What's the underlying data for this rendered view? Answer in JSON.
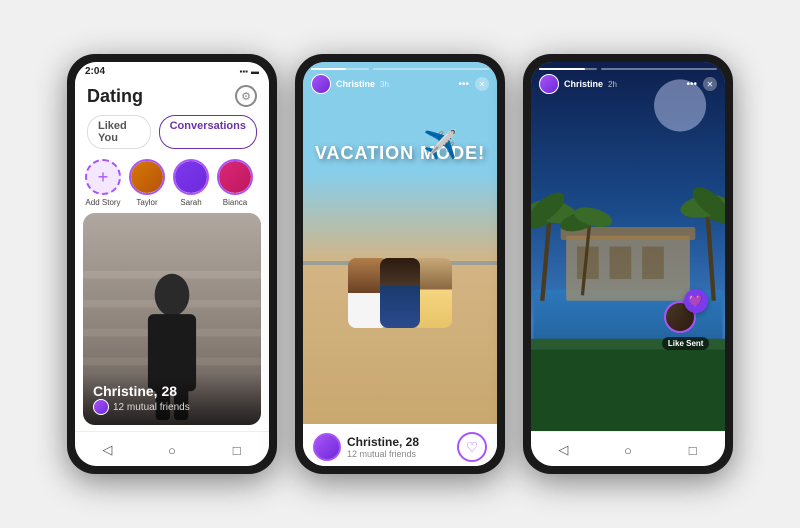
{
  "phone1": {
    "status_bar": {
      "time": "2:04",
      "icons": "▪▪ ▬"
    },
    "app_title": "Dating",
    "gear_label": "⚙",
    "tabs": [
      {
        "label": "Liked You",
        "id": "liked"
      },
      {
        "label": "Conversations",
        "id": "conversations"
      }
    ],
    "stories": [
      {
        "label": "Add Story",
        "type": "add"
      },
      {
        "label": "Taylor",
        "type": "avatar",
        "color": "av-taylor"
      },
      {
        "label": "Sarah",
        "type": "avatar",
        "color": "av-sarah"
      },
      {
        "label": "Bianca",
        "type": "avatar",
        "color": "av-bianca"
      }
    ],
    "card": {
      "name": "Christine, 28",
      "mutual": "12 mutual friends"
    }
  },
  "phone2": {
    "story_user": "Christine",
    "story_time": "3h",
    "overlay_text": "VACATION MODE!",
    "card": {
      "name": "Christine, 28",
      "mutual": "12 mutual friends"
    }
  },
  "phone3": {
    "story_user": "Christine",
    "story_time": "2h",
    "like_sent_label": "Like Sent"
  },
  "nav": {
    "back": "◁",
    "home": "○",
    "recent": "□"
  }
}
